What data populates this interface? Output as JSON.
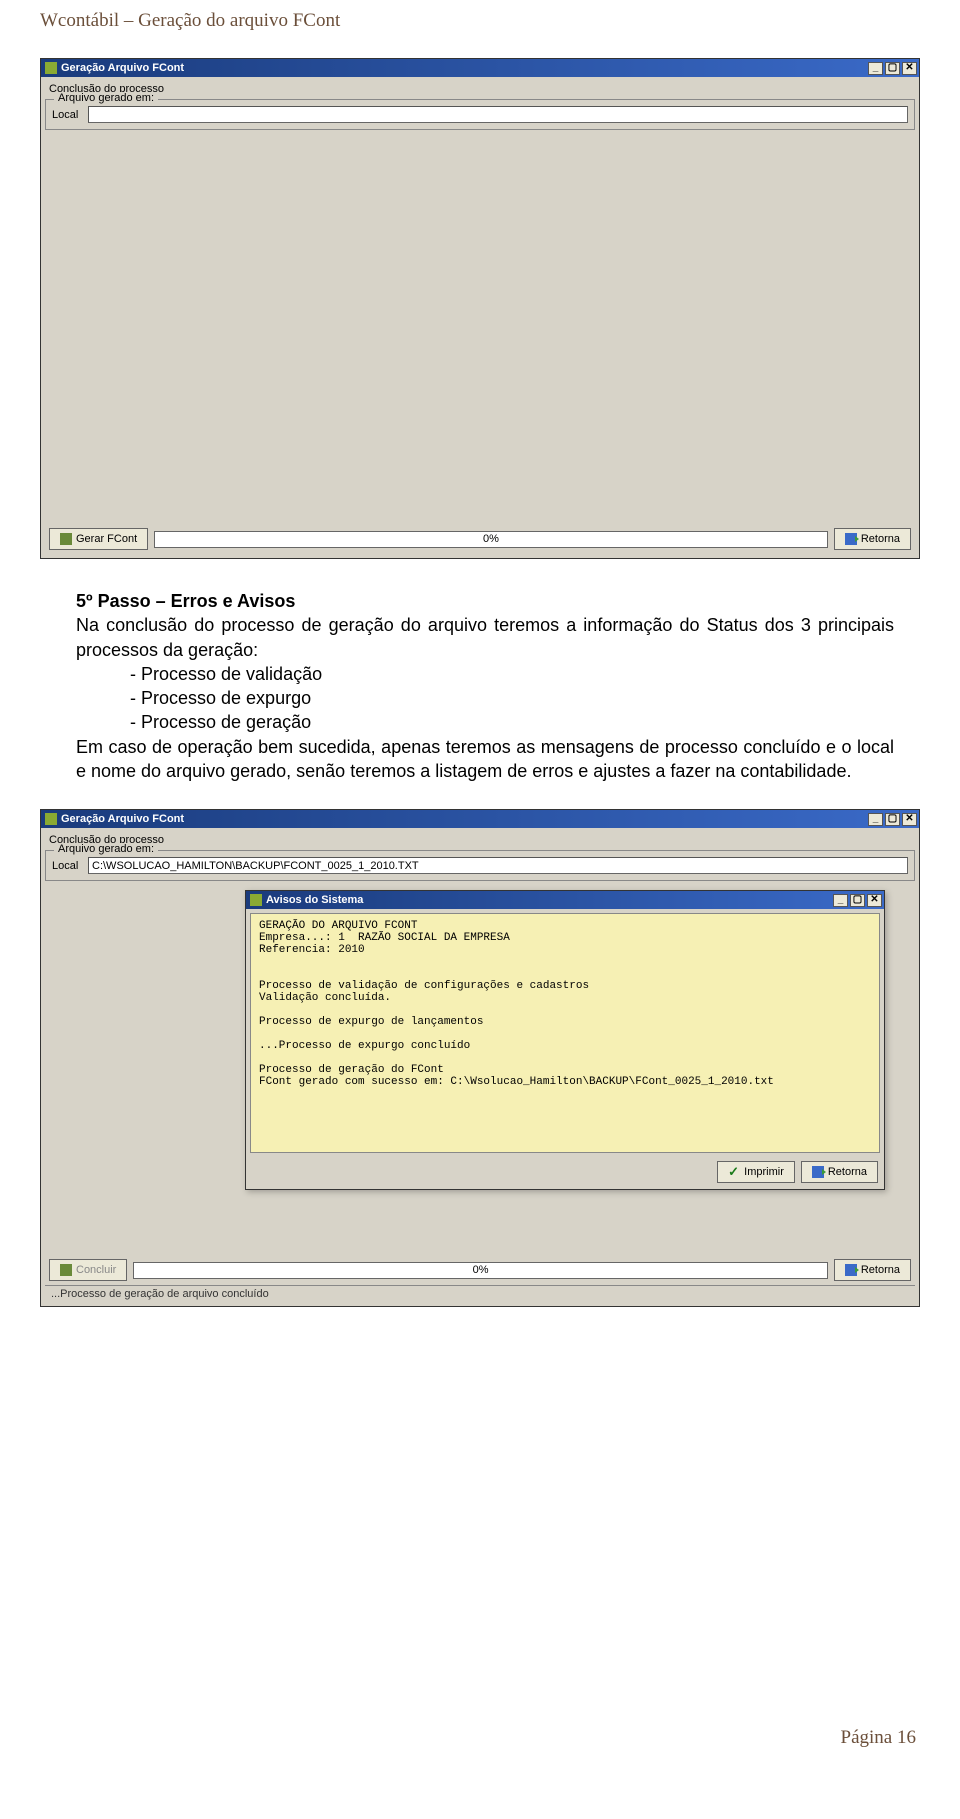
{
  "doc_header": "Wcontábil – Geração do arquivo FCont",
  "win1": {
    "title": "Geração Arquivo FCont",
    "subtitle": "Conclusão do processo",
    "group_label": "Arquivo gerado em:",
    "local_label": "Local",
    "local_value": "",
    "btn_gerar": "Gerar FCont",
    "progress_text": "0%",
    "btn_retorna": "Retorna"
  },
  "body": {
    "title": "5º Passo – Erros e Avisos",
    "p1": "Na conclusão do processo de geração do arquivo teremos a informação do Status dos 3 principais processos da geração:",
    "b1": "- Processo de validação",
    "b2": "- Processo de expurgo",
    "b3": "- Processo de geração",
    "p2": "Em caso de operação bem sucedida, apenas teremos as mensagens de processo concluído e o local e nome do arquivo gerado, senão teremos a listagem de erros e ajustes a fazer na contabilidade."
  },
  "win2": {
    "title": "Geração Arquivo FCont",
    "subtitle": "Conclusão do processo",
    "group_label": "Arquivo gerado em:",
    "local_label": "Local",
    "local_value": "C:\\WSOLUCAO_HAMILTON\\BACKUP\\FCONT_0025_1_2010.TXT",
    "btn_concluir": "Concluir",
    "progress_text": "0%",
    "btn_retorna": "Retorna",
    "statusbar": "...Processo de geração de arquivo concluído"
  },
  "popup": {
    "title": "Avisos do Sistema",
    "lines": [
      "GERAÇÃO DO ARQUIVO FCONT",
      "Empresa...: 1  RAZÃO SOCIAL DA EMPRESA",
      "Referencia: 2010",
      "",
      "",
      "Processo de validação de configurações e cadastros",
      "Validação concluída.",
      "",
      "Processo de expurgo de lançamentos",
      "",
      "...Processo de expurgo concluído",
      "",
      "Processo de geração do FCont",
      "FCont gerado com sucesso em: C:\\Wsolucao_Hamilton\\BACKUP\\FCont_0025_1_2010.txt"
    ],
    "btn_imprimir": "Imprimir",
    "btn_retorna": "Retorna"
  },
  "page_footer": "Página 16"
}
